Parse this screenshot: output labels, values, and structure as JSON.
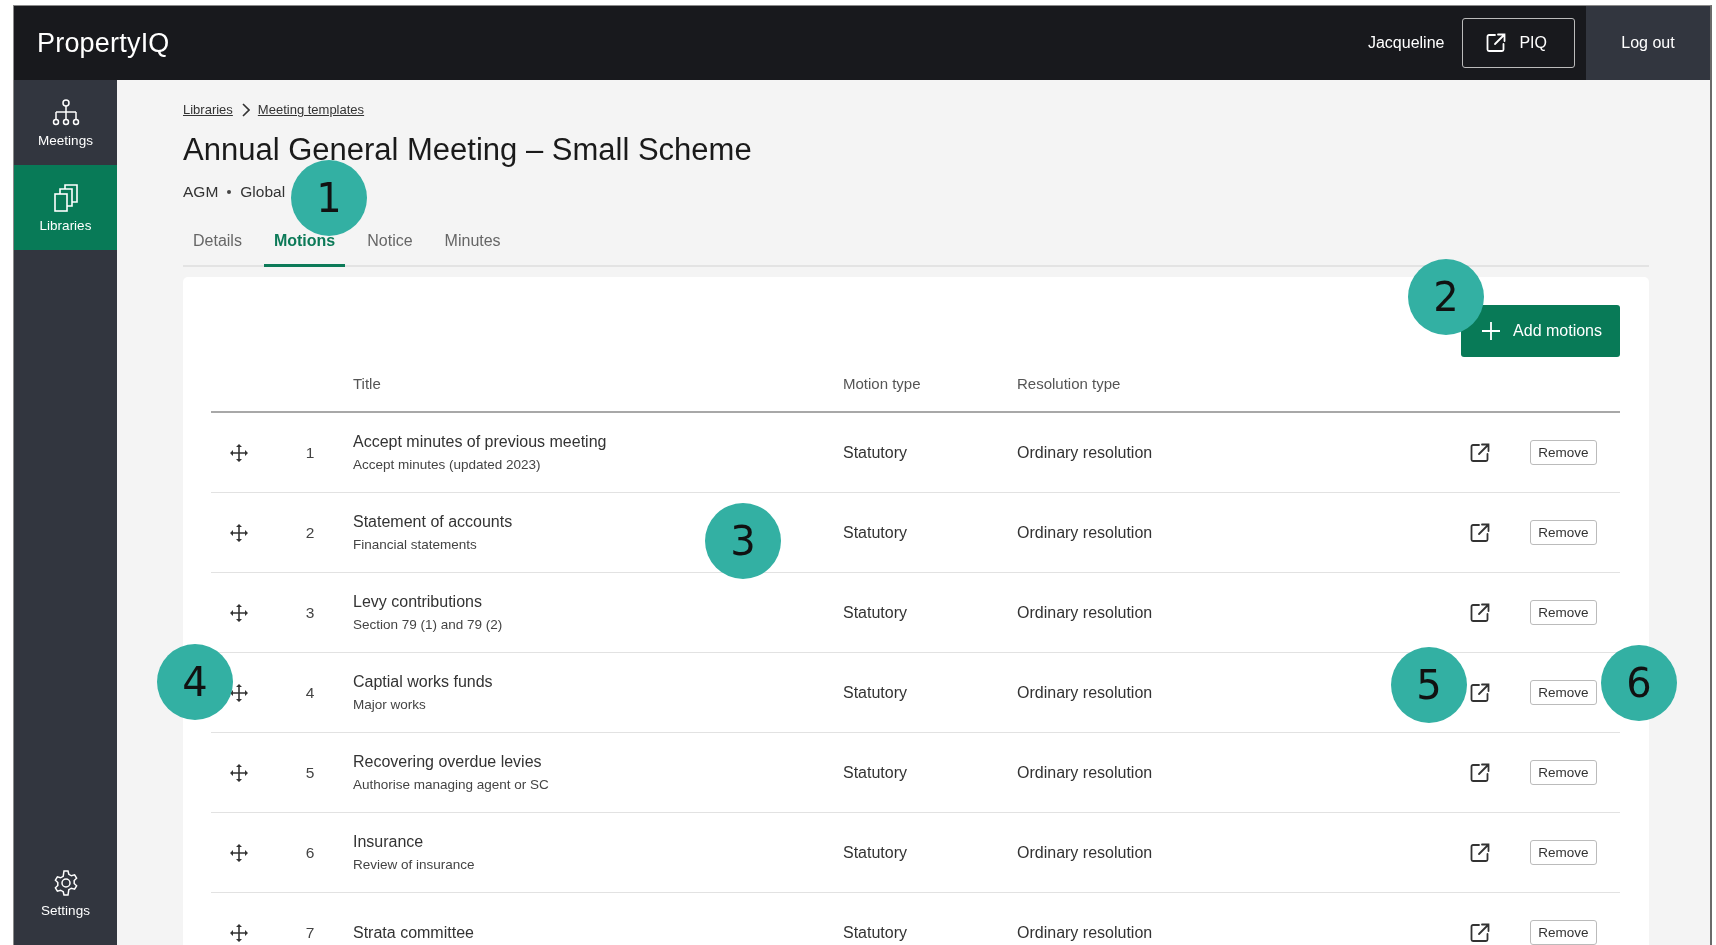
{
  "topbar": {
    "logo": "PropertyIQ",
    "user": "Jacqueline",
    "piq_button": "PIQ",
    "logout": "Log out"
  },
  "sidebar": {
    "items": [
      {
        "label": "Meetings",
        "selected": false
      },
      {
        "label": "Libraries",
        "selected": true
      }
    ],
    "footer": {
      "label": "Settings"
    }
  },
  "breadcrumb": [
    "Libraries",
    "Meeting templates"
  ],
  "title": "Annual General Meeting – Small Scheme",
  "meta": [
    "AGM",
    "Global"
  ],
  "tabs": [
    {
      "label": "Details",
      "selected": false
    },
    {
      "label": "Motions",
      "selected": true
    },
    {
      "label": "Notice",
      "selected": false
    },
    {
      "label": "Minutes",
      "selected": false
    }
  ],
  "add_button": "Add motions",
  "table": {
    "columns": [
      "Title",
      "Motion type",
      "Resolution type"
    ],
    "rows": [
      {
        "number": "1",
        "title": "Accept minutes of previous meeting",
        "subtitle": "Accept minutes (updated 2023)",
        "motion_type": "Statutory",
        "resolution_type": "Ordinary resolution",
        "action": "Remove"
      },
      {
        "number": "2",
        "title": "Statement of accounts",
        "subtitle": "Financial statements",
        "motion_type": "Statutory",
        "resolution_type": "Ordinary resolution",
        "action": "Remove"
      },
      {
        "number": "3",
        "title": "Levy contributions",
        "subtitle": "Section 79 (1) and 79 (2)",
        "motion_type": "Statutory",
        "resolution_type": "Ordinary resolution",
        "action": "Remove"
      },
      {
        "number": "4",
        "title": "Captial works funds",
        "subtitle": "Major works",
        "motion_type": "Statutory",
        "resolution_type": "Ordinary resolution",
        "action": "Remove"
      },
      {
        "number": "5",
        "title": "Recovering overdue levies",
        "subtitle": "Authorise managing agent or SC",
        "motion_type": "Statutory",
        "resolution_type": "Ordinary resolution",
        "action": "Remove"
      },
      {
        "number": "6",
        "title": "Insurance",
        "subtitle": "Review of insurance",
        "motion_type": "Statutory",
        "resolution_type": "Ordinary resolution",
        "action": "Remove"
      },
      {
        "number": "7",
        "title": "Strata committee",
        "motion_type": "Statutory",
        "resolution_type": "Ordinary resolution",
        "action": "Remove"
      }
    ]
  },
  "callouts": [
    "1",
    "2",
    "3",
    "4",
    "5",
    "6"
  ]
}
